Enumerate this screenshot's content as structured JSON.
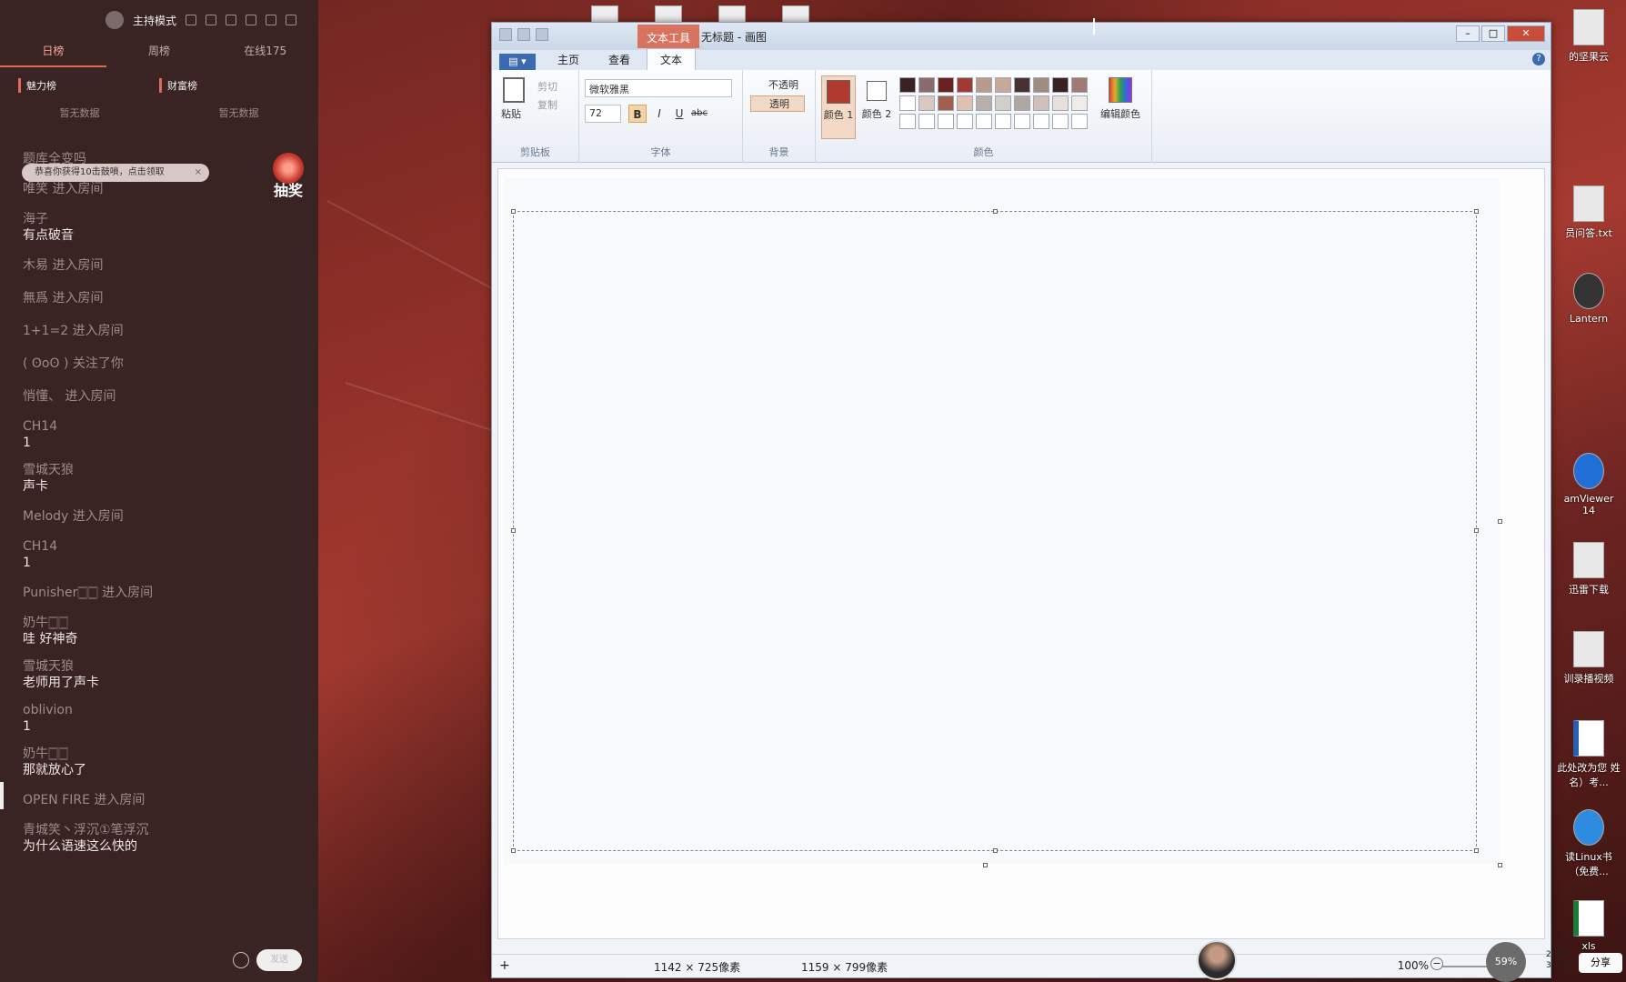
{
  "live_panel": {
    "mode_label": "主持模式",
    "tabs": [
      "日榜",
      "周榜",
      "在线175"
    ],
    "active_tab": 0,
    "ranks": [
      {
        "title": "魅力榜",
        "empty": "暂无数据"
      },
      {
        "title": "财富榜",
        "empty": "暂无数据"
      }
    ],
    "notice": "恭喜你获得10击鼓嗩，点击领取",
    "lottery_label": "抽奖",
    "chat": [
      {
        "type": "msg",
        "name": "题库全变吗",
        "text": ""
      },
      {
        "type": "enter",
        "text": "唯笑 进入房间"
      },
      {
        "type": "msg",
        "name": "海子",
        "text": "有点破音"
      },
      {
        "type": "enter",
        "text": "木易 进入房间"
      },
      {
        "type": "enter",
        "text": "無爲 进入房间"
      },
      {
        "type": "enter",
        "text": "1+1=2 进入房间"
      },
      {
        "type": "enter",
        "text": "( ʘoʘ ) 关注了你"
      },
      {
        "type": "enter",
        "text": "悄懂、 进入房间"
      },
      {
        "type": "msg",
        "name": "CH14",
        "text": "1"
      },
      {
        "type": "msg",
        "name": "雪城天狼",
        "text": "声卡"
      },
      {
        "type": "enter",
        "text": "Melody 进入房间"
      },
      {
        "type": "msg",
        "name": "CH14",
        "text": "1"
      },
      {
        "type": "enter",
        "text": "Punisher🀆🀆 进入房间"
      },
      {
        "type": "msg",
        "name": "奶牛🀆🀆",
        "text": "哇 好神奇"
      },
      {
        "type": "msg",
        "name": "雪城天狼",
        "text": "老师用了声卡"
      },
      {
        "type": "msg",
        "name": "oblivion",
        "text": "1"
      },
      {
        "type": "msg",
        "name": "奶牛🀆🀆",
        "text": "那就放心了"
      },
      {
        "type": "enter",
        "text": "OPEN FIRE 进入房间"
      },
      {
        "type": "msg",
        "name": "青城笑丶浮沉①笔浮沉",
        "text": "为什么语速这么快的"
      }
    ],
    "send_placeholder": "发送"
  },
  "paint": {
    "context_tab": "文本工具",
    "title": "无标题 - 画图",
    "ribbon_tabs": [
      "主页",
      "查看",
      "文本"
    ],
    "active_ribbon_tab": "文本",
    "help": "?",
    "clipboard": {
      "paste": "粘贴",
      "cut": "剪切",
      "copy": "复制",
      "group": "剪贴板"
    },
    "font": {
      "name": "微软雅黑",
      "size": "72",
      "bold": "B",
      "italic": "I",
      "underline": "U",
      "strike": "abc",
      "group": "字体"
    },
    "background": {
      "opaque": "不透明",
      "transparent": "透明",
      "group": "背景"
    },
    "colors": {
      "color1_label": "颜色 1",
      "color2_label": "颜色 2",
      "edit": "编辑颜色",
      "group": "颜色",
      "color1": "#b03a2e",
      "color2": "#ffffff",
      "palette": [
        "#3b2121",
        "#8a6b6b",
        "#6b2020",
        "#a23a30",
        "#b99a8a",
        "#c9a89a",
        "#4a3030",
        "#a08c80",
        "#3a2020",
        "#a07a70",
        "#ffffff",
        "#d8c8c0",
        "#a06050",
        "#e0c0b0",
        "#b8b0a8",
        "#d0d0c8",
        "#b0a8a0",
        "#d0c0b8",
        "#e8e0d8",
        "#f0ece8",
        "#ffffff",
        "#ffffff",
        "#ffffff",
        "#ffffff",
        "#ffffff",
        "#ffffff",
        "#ffffff",
        "#ffffff",
        "#ffffff",
        "#ffffff"
      ]
    },
    "status": {
      "selection_size": "1142 × 725像素",
      "image_size": "1159 × 799像素",
      "zoom": "100%"
    }
  },
  "desktop_icons": [
    {
      "label": "的坚果云",
      "kind": "folder"
    },
    {
      "label": "员问答.txt",
      "kind": "doc"
    },
    {
      "label": "Lantern",
      "kind": "round"
    },
    {
      "label": "amViewer 14",
      "kind": "tv"
    },
    {
      "label": "迅雷下载",
      "kind": "doc"
    },
    {
      "label": "训录播视频",
      "kind": "doc"
    },
    {
      "label": "此处改为您 姓名）考...",
      "kind": "word"
    },
    {
      "label": "读Linux书 （免费...",
      "kind": "ie"
    },
    {
      "label": "xls",
      "kind": "xls"
    }
  ],
  "tray": {
    "battery": "59%",
    "up": "20K/s",
    "down": "3.4K/s",
    "share": "分享"
  }
}
